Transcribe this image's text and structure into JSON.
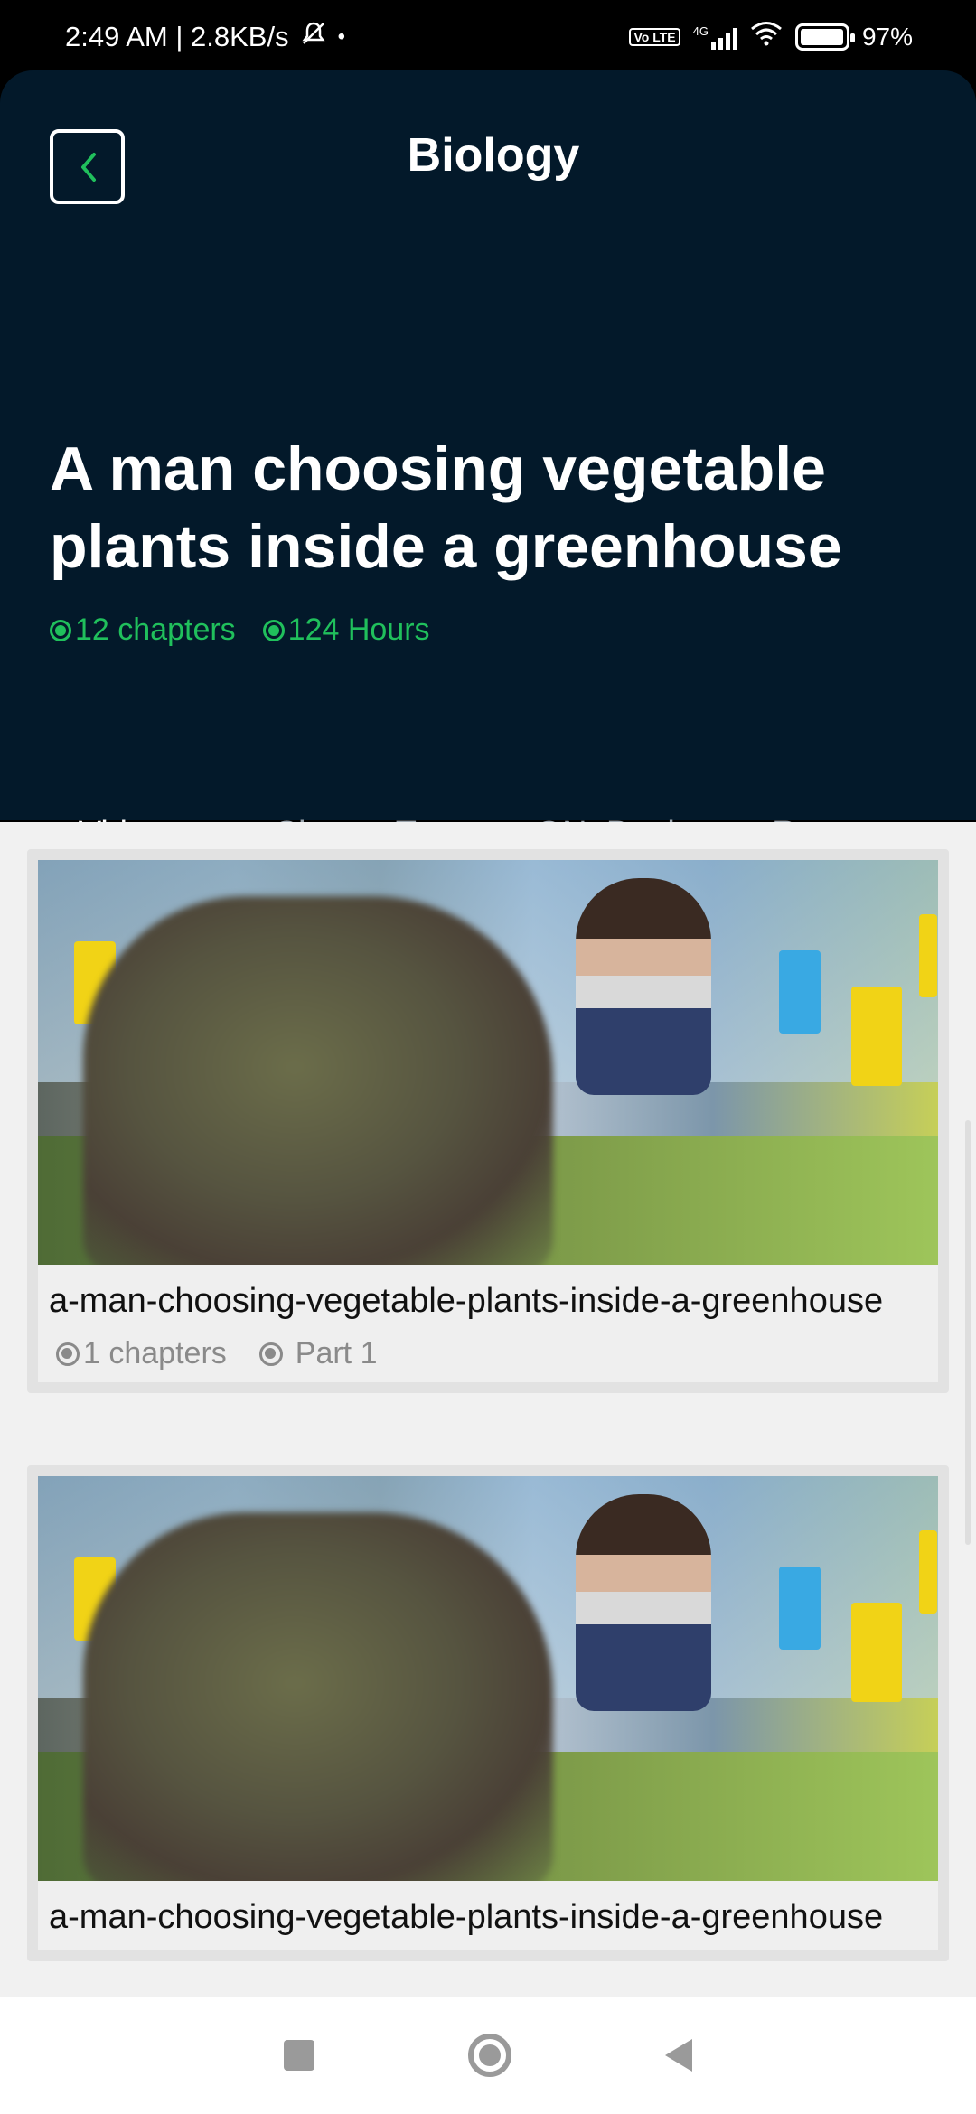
{
  "status_bar": {
    "time_speed": "2:49 AM | 2.8KB/s",
    "network": "4G",
    "volte": "Vo LTE",
    "battery": "97%",
    "battery_level": 0.97
  },
  "header": {
    "back_icon": "chevron-left-icon",
    "title": "Biology",
    "course_title": "A man choosing vegetable plants inside a greenhouse",
    "chapters": "12 chapters",
    "hours": "124 Hours",
    "accent_color": "#20c05c",
    "background_color": "#03192a"
  },
  "tabs": [
    {
      "label": "Video",
      "active": true
    },
    {
      "label": "ChapterTest",
      "active": false
    },
    {
      "label": "QN_Bank",
      "active": false
    },
    {
      "label": "Resources",
      "active": false
    }
  ],
  "videos": [
    {
      "title": "a-man-choosing-vegetable-plants-inside-a-greenhouse",
      "chapters": "1 chapters",
      "part": "Part 1"
    },
    {
      "title": "a-man-choosing-vegetable-plants-inside-a-greenhouse",
      "chapters": "",
      "part": ""
    }
  ],
  "nav_bar": {
    "recents_icon": "square-icon",
    "home_icon": "circle-icon",
    "back_icon": "triangle-back-icon"
  }
}
